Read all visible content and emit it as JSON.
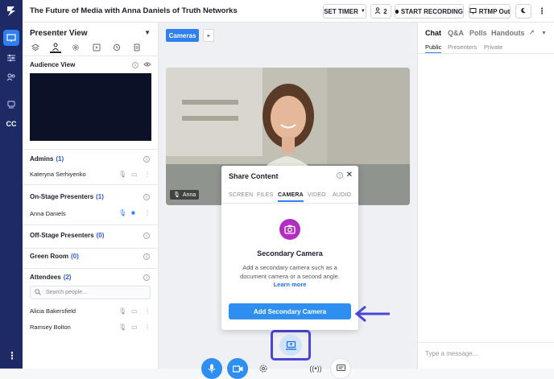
{
  "app": {
    "title": "The Future of Media with Anna Daniels of Truth Networks"
  },
  "topbar": {
    "set_timer": "SET TIMER",
    "viewer_count": "2",
    "start_recording": "START RECORDING",
    "rtmp_out": "RTMP Out"
  },
  "rail": {
    "cc_label": "CC"
  },
  "presenter_view": {
    "title": "Presenter View",
    "audience_view": "Audience View",
    "admins": {
      "label": "Admins",
      "count": "(1)"
    },
    "admin_person": "Kateryna Serhiyenko",
    "on_stage": {
      "label": "On-Stage Presenters",
      "count": "(1)"
    },
    "on_stage_person": "Anna Daniels",
    "off_stage": {
      "label": "Off-Stage Presenters",
      "count": "(0)"
    },
    "green_room": {
      "label": "Green Room",
      "count": "(0)"
    },
    "attendees": {
      "label": "Attendees",
      "count": "(2)"
    },
    "search_placeholder": "Search people...",
    "attendee_list": [
      "Alicia Bakersfield",
      "Ramsey Bolton"
    ]
  },
  "stage": {
    "tab_cameras": "Cameras",
    "tab_add": "+",
    "name_tag": "Anna"
  },
  "share_dialog": {
    "title": "Share Content",
    "tabs": [
      "SCREEN",
      "FILES",
      "CAMERA",
      "VIDEO",
      "AUDIO"
    ],
    "selected_tab": "CAMERA",
    "heading": "Secondary Camera",
    "description": "Add a secondary camera such as a document camera or a second angle.",
    "link": "Learn more",
    "button": "Add Secondary Camera"
  },
  "chat": {
    "tabs": [
      "Chat",
      "Q&A",
      "Polls",
      "Handouts"
    ],
    "subtabs": [
      "Public",
      "Presenters",
      "Private"
    ],
    "input_placeholder": "Type a message..."
  },
  "colors": {
    "rail": "#1d2a66",
    "accent": "#2f7ff0",
    "highlight_outline": "#4b47d6",
    "camera_badge": "#b12fc0"
  }
}
